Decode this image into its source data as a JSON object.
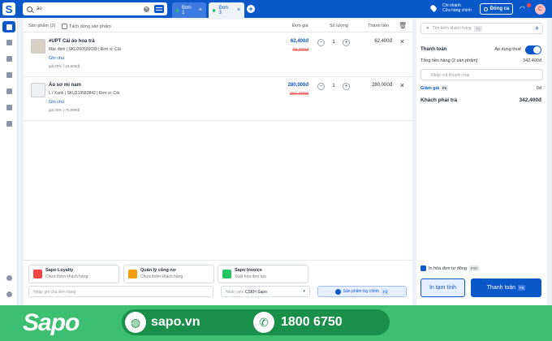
{
  "topbar": {
    "search_value": "áo",
    "tabs": [
      {
        "label": "Đơn 1"
      },
      {
        "label": "Đơn 3"
      }
    ],
    "branch_line1": "Chi nhánh",
    "branch_line2": "Cửa hàng chính",
    "close_shift": "Đóng ca",
    "avatar_letter": "C"
  },
  "table": {
    "header_products": "Sản phẩm (2)",
    "header_split": "Tách dòng sản phẩm",
    "header_price": "Đơn giá",
    "header_qty": "Số lượng",
    "header_total": "Thành tiền"
  },
  "items": [
    {
      "name": "#UPT Cái áo hoa trà",
      "variant": "Mặc định",
      "sku": "SKU260500039",
      "unit": "Đơn vị: Cái",
      "note": "Ghi chú",
      "promo": "giả 20% (-15,600đ)",
      "price": "62,400đ",
      "old_price": "78,000đ",
      "qty": "1",
      "total": "62,400đ"
    },
    {
      "name": "Áo sơ mi nam",
      "variant": "L / Xanh",
      "sku": "SKU219583842",
      "unit": "Đơn vị: Cái",
      "note": "Ghi chú",
      "promo": "giả 20% (-70,000đ)",
      "price": "280,000đ",
      "old_price": "350,000đ",
      "qty": "1",
      "total": "280,000đ"
    }
  ],
  "bottom": {
    "loyalty_title": "Sapo Loyalty",
    "loyalty_sub": "Chưa thêm khách hàng",
    "debt_title": "Quản lý công nợ",
    "debt_sub": "Chưa thêm khách hàng",
    "invoice_title": "Sapo Invoice",
    "invoice_sub": "Xuất hóa đơn lưu",
    "note_placeholder": "Nhập ghi chú đơn hàng",
    "staff_label": "Nhân viên",
    "staff_value": "CSKH Sapo",
    "custom_product": "Sản phẩm tùy chỉnh",
    "custom_key": "F2"
  },
  "right": {
    "customer_search": "Tìm kiếm khách hàng",
    "customer_key": "F4",
    "payment_title": "Thanh toán",
    "tax_label": "Áp dụng thuế",
    "subtotal_label": "Tổng tiền hàng (2 sản phẩm)",
    "subtotal_value": "342,400đ",
    "tax_placeholder": "Nhập mã khuyến mại",
    "discount_label": "Giảm giá",
    "discount_key": "F6",
    "discount_value": "0đ",
    "pay_label": "Khách phải trả",
    "pay_value": "342,400đ",
    "print_label": "In hóa đơn tự động",
    "print_key": "F10",
    "btn_print": "In tạm tính",
    "btn_pay": "Thanh toán",
    "btn_pay_key": "F9"
  },
  "banner": {
    "logo": "Sapo",
    "website": "sapo.vn",
    "hotline": "1800 6750"
  },
  "colors": {
    "primary": "#0a58ca",
    "banner": "#3dbf71",
    "danger": "#ef4444"
  }
}
